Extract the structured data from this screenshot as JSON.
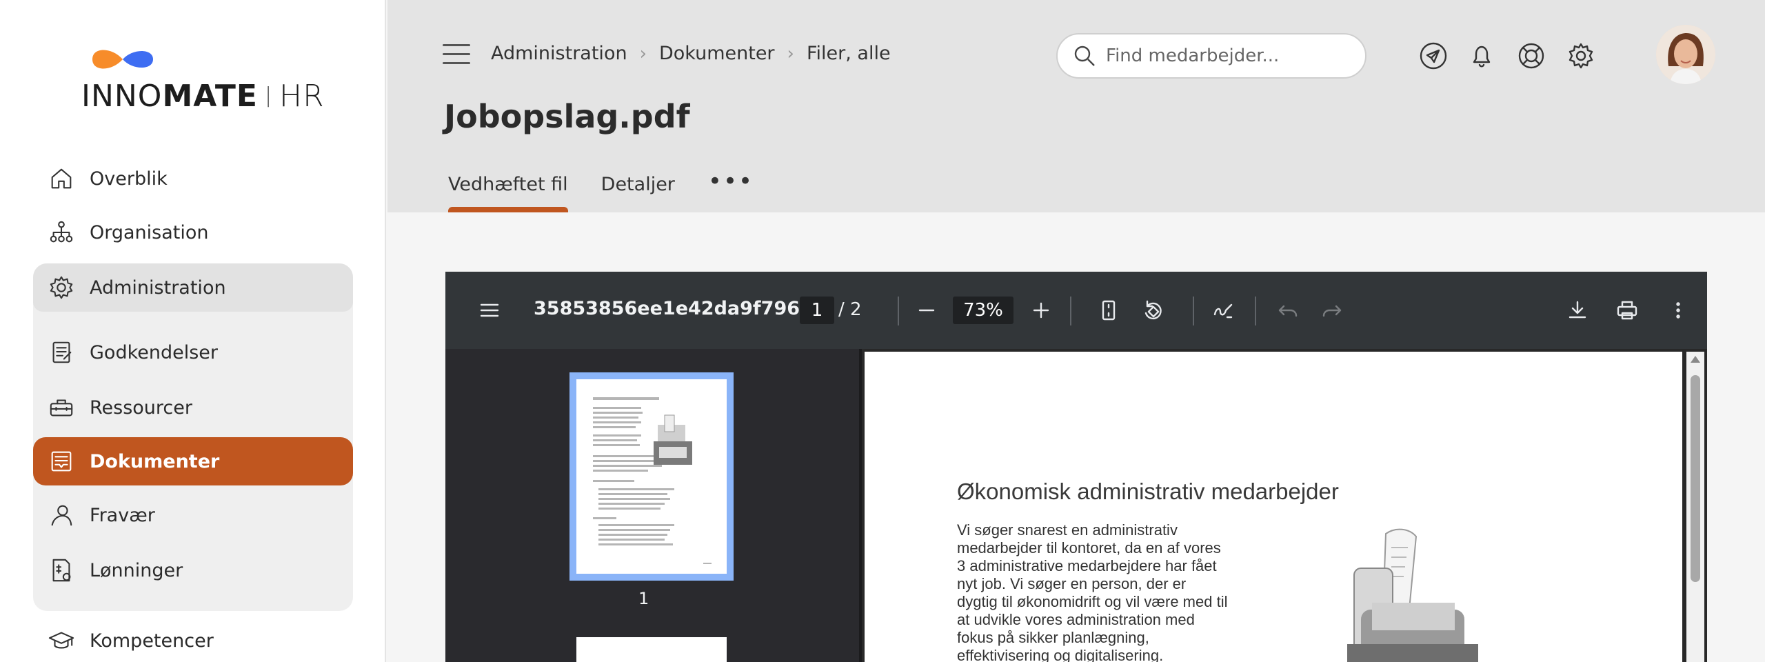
{
  "brand": {
    "name_left": "INNO",
    "name_mid": "MATE",
    "name_right": "HR",
    "logo_orange": "#f78c2a",
    "logo_blue": "#3e6df2"
  },
  "sidebar": {
    "items": [
      {
        "label": "Overblik",
        "icon": "home-icon"
      },
      {
        "label": "Organisation",
        "icon": "org-chart-icon"
      },
      {
        "label": "Administration",
        "icon": "gear-icon"
      },
      {
        "label": "Godkendelser",
        "icon": "checklist-icon"
      },
      {
        "label": "Ressourcer",
        "icon": "toolbox-icon"
      },
      {
        "label": "Dokumenter",
        "icon": "document-icon"
      },
      {
        "label": "Fravær",
        "icon": "person-icon"
      },
      {
        "label": "Lønninger",
        "icon": "payslip-icon"
      },
      {
        "label": "Kompetencer",
        "icon": "graduation-cap-icon"
      }
    ],
    "active_item": "Dokumenter",
    "accent": "#c0561f"
  },
  "header": {
    "breadcrumb": [
      "Administration",
      "Dokumenter",
      "Filer, alle"
    ],
    "search_placeholder": "Find medarbejder...",
    "page_title": "Jobopslag.pdf",
    "tabs": [
      {
        "label": "Vedhæftet fil",
        "active": true
      },
      {
        "label": "Detaljer",
        "active": false
      }
    ],
    "more": "•••"
  },
  "viewer": {
    "filename": "35853856ee1e42da9f796...",
    "current_page": "1",
    "page_count": "/ 2",
    "zoom": "73%",
    "thumbnail_label": "1",
    "document": {
      "title": "Økonomisk administrativ medarbejder",
      "body_lines": [
        "Vi søger snarest en administrativ",
        "medarbejder til kontoret, da en af vores",
        "3 administrative medarbejdere har fået",
        "nyt job. Vi søger en person, der er",
        "dygtig til økonomidrift og vil være med til",
        "at udvikle vores administration med",
        "fokus på sikker planlægning,",
        "effektivisering og digitalisering."
      ]
    }
  }
}
